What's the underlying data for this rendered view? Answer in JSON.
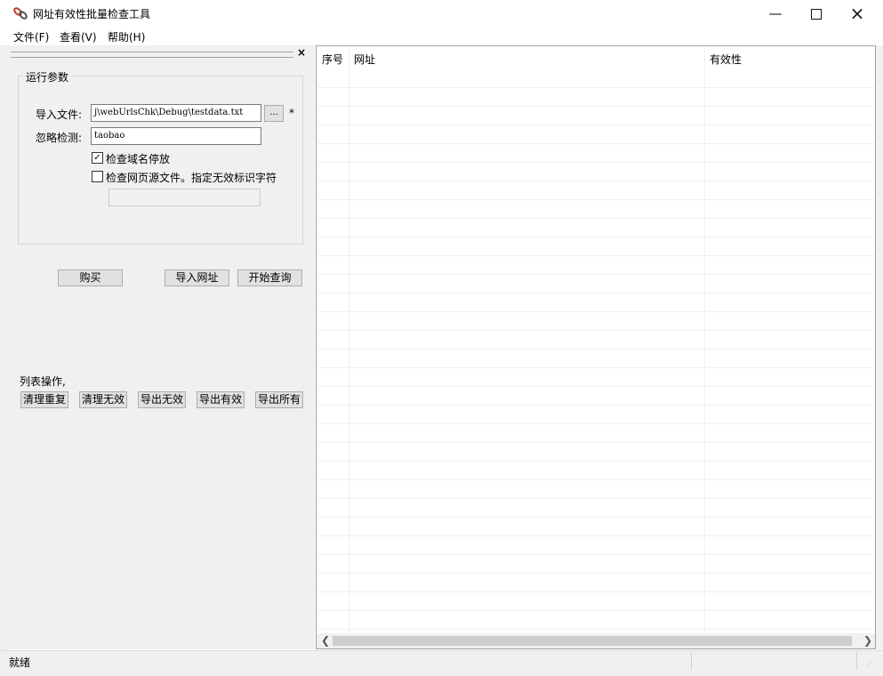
{
  "window": {
    "title": "网址有效性批量检查工具"
  },
  "menu": {
    "items": [
      "文件(F)",
      "查看(V)",
      "帮助(H)"
    ]
  },
  "pane": {
    "close_glyph": "×"
  },
  "params": {
    "group_title": "运行参数",
    "import_label": "导入文件:",
    "import_value": "j\\webUrlsChk\\Debug\\testdata.txt",
    "browse_label": "...",
    "required_mark": "*",
    "ignore_label": "忽略检测:",
    "ignore_value": "taobao",
    "check_parking_label": "检查域名停放",
    "check_parking_checked": true,
    "check_source_label": "检查网页源文件。指定无效标识字符",
    "check_source_checked": false,
    "invalid_marker_value": ""
  },
  "actions": {
    "buy": "购买",
    "import_urls": "导入网址",
    "start_query": "开始查询"
  },
  "list_ops": {
    "title": "列表操作,",
    "buttons": [
      "清理重复",
      "清理无效",
      "导出无效",
      "导出有效",
      "导出所有"
    ]
  },
  "grid": {
    "columns": [
      "序号",
      "网址",
      "有效性"
    ],
    "rows": []
  },
  "status": {
    "text": "就绪"
  }
}
